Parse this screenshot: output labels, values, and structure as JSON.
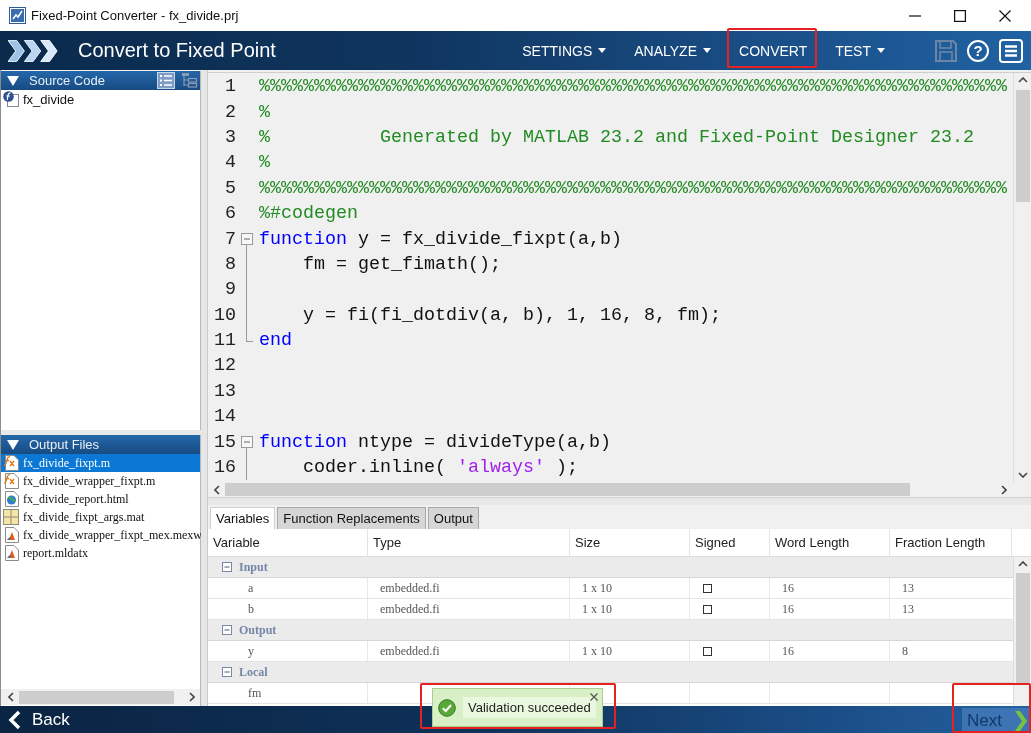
{
  "window": {
    "title": "Fixed-Point Converter - fx_divide.prj"
  },
  "header": {
    "title": "Convert to Fixed Point",
    "menu": [
      {
        "label": "SETTINGS",
        "dropdown": true,
        "highlighted": false
      },
      {
        "label": "ANALYZE",
        "dropdown": true,
        "highlighted": false
      },
      {
        "label": "CONVERT",
        "dropdown": false,
        "highlighted": true
      },
      {
        "label": "TEST",
        "dropdown": true,
        "highlighted": false
      }
    ],
    "tools": [
      {
        "kind": "save",
        "disabled": true
      },
      {
        "kind": "help",
        "glyph": "?",
        "disabled": false
      },
      {
        "kind": "menu",
        "disabled": false
      }
    ]
  },
  "source_panel": {
    "title": "Source Code",
    "expanded": true,
    "views": [
      {
        "kind": "list",
        "selected": true
      },
      {
        "kind": "tree",
        "selected": false
      }
    ],
    "items": [
      {
        "name": "fx_divide",
        "kind": "function",
        "selected": false
      }
    ]
  },
  "output_panel": {
    "title": "Output Files",
    "expanded": true,
    "items": [
      {
        "name": "fx_divide_fixpt.m",
        "kind": "script",
        "selected": true
      },
      {
        "name": "fx_divide_wrapper_fixpt.m",
        "kind": "script",
        "selected": false
      },
      {
        "name": "fx_divide_report.html",
        "kind": "html",
        "selected": false
      },
      {
        "name": "fx_divide_fixpt_args.mat",
        "kind": "mat",
        "selected": false
      },
      {
        "name": "fx_divide_wrapper_fixpt_mex.mexw",
        "kind": "mex",
        "selected": false
      },
      {
        "name": "report.mldatx",
        "kind": "mex",
        "selected": false
      }
    ]
  },
  "editor": {
    "lines": [
      {
        "number": "1",
        "kind": "plain",
        "segments": [
          {
            "kind": "comment",
            "text": "%%%%%%%%%%%%%%%%%%%%%%%%%%%%%%%%%%%%%%%%%%%%%%%%%%%%%%%%%%%%%%%%%%%%"
          }
        ]
      },
      {
        "number": "2",
        "kind": "plain",
        "segments": [
          {
            "kind": "comment",
            "text": "%"
          }
        ]
      },
      {
        "number": "3",
        "kind": "plain",
        "segments": [
          {
            "kind": "comment",
            "text": "%          Generated by MATLAB 23.2 and Fixed-Point Designer 23.2"
          }
        ]
      },
      {
        "number": "4",
        "kind": "plain",
        "segments": [
          {
            "kind": "comment",
            "text": "%"
          }
        ]
      },
      {
        "number": "5",
        "kind": "plain",
        "segments": [
          {
            "kind": "comment",
            "text": "%%%%%%%%%%%%%%%%%%%%%%%%%%%%%%%%%%%%%%%%%%%%%%%%%%%%%%%%%%%%%%%%%%%%"
          }
        ]
      },
      {
        "number": "6",
        "kind": "plain",
        "segments": [
          {
            "kind": "comment",
            "text": "%#codegen"
          }
        ]
      },
      {
        "number": "7",
        "kind": "opener",
        "segments": [
          {
            "kind": "keyword",
            "text": "function"
          },
          {
            "kind": "plain",
            "text": " y = fx_divide_fixpt(a,b)"
          }
        ]
      },
      {
        "number": "8",
        "kind": "inner",
        "segments": [
          {
            "kind": "plain",
            "text": "    fm = get_fimath();"
          }
        ]
      },
      {
        "number": "9",
        "kind": "inner"
      },
      {
        "number": "10",
        "kind": "inner",
        "segments": [
          {
            "kind": "plain",
            "text": "    y = fi(fi_dotdiv(a, b), 1, 16, 8, fm);"
          }
        ]
      },
      {
        "number": "11",
        "kind": "closer",
        "segments": [
          {
            "kind": "keyword",
            "text": "end"
          }
        ]
      },
      {
        "number": "12",
        "kind": "plain"
      },
      {
        "number": "13",
        "kind": "plain"
      },
      {
        "number": "14",
        "kind": "plain"
      },
      {
        "number": "15",
        "kind": "opener",
        "segments": [
          {
            "kind": "keyword",
            "text": "function"
          },
          {
            "kind": "plain",
            "text": " ntype = divideType(a,b)"
          }
        ]
      },
      {
        "number": "16",
        "kind": "inner",
        "segments": [
          {
            "kind": "plain",
            "text": "    coder.inline( "
          },
          {
            "kind": "string",
            "text": "'always'"
          },
          {
            "kind": "plain",
            "text": " );"
          }
        ]
      }
    ]
  },
  "tabs": [
    {
      "label": "Variables",
      "selected": true
    },
    {
      "label": "Function Replacements",
      "selected": false
    },
    {
      "label": "Output",
      "selected": false
    }
  ],
  "table": {
    "columns": [
      "Variable",
      "Type",
      "Size",
      "Signed",
      "Word Length",
      "Fraction Length"
    ],
    "groups": [
      {
        "name": "Input",
        "expanded": true,
        "rows": [
          {
            "variable": "a",
            "type": "embedded.fi",
            "size": "1 x 10",
            "signed": false,
            "word_length": "16",
            "fraction_length": "13"
          },
          {
            "variable": "b",
            "type": "embedded.fi",
            "size": "1 x 10",
            "signed": false,
            "word_length": "16",
            "fraction_length": "13"
          }
        ]
      },
      {
        "name": "Output",
        "expanded": true,
        "rows": [
          {
            "variable": "y",
            "type": "embedded.fi",
            "size": "1 x 10",
            "signed": false,
            "word_length": "16",
            "fraction_length": "8"
          }
        ]
      },
      {
        "name": "Local",
        "expanded": true,
        "rows": [
          {
            "variable": "fm"
          }
        ]
      }
    ]
  },
  "footer": {
    "back": {
      "label": "Back",
      "highlighted": false
    },
    "next": {
      "label": "Next",
      "highlighted": true
    }
  },
  "toast": {
    "message": "Validation succeeded",
    "highlighted": true
  }
}
